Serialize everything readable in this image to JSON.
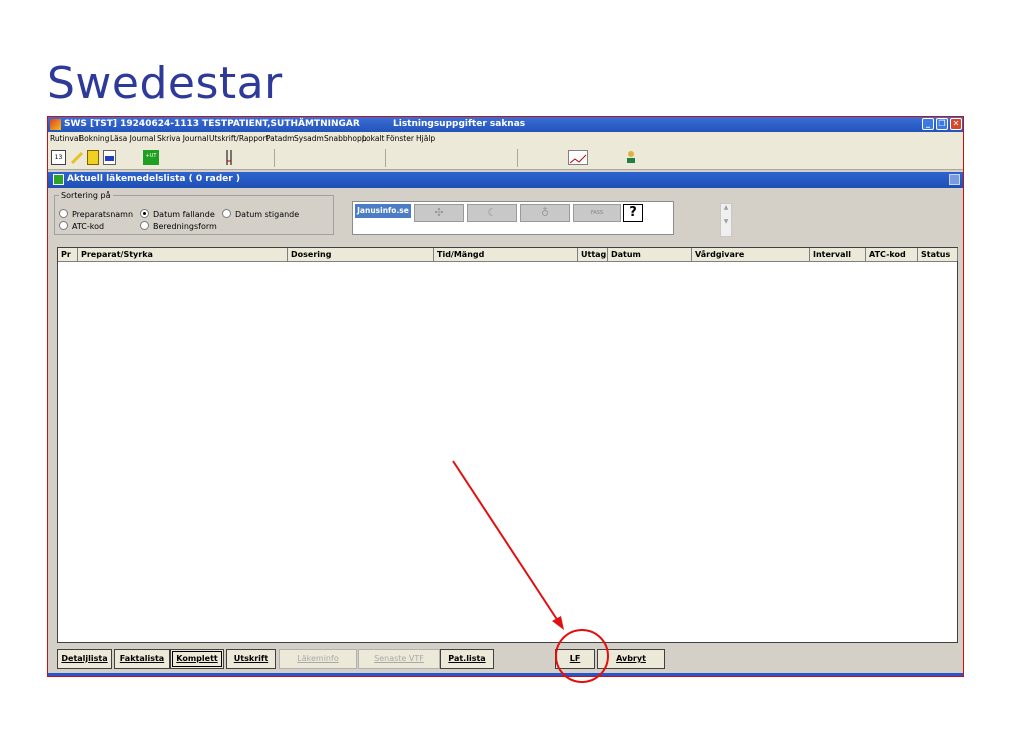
{
  "slide": {
    "title": "Swedestar"
  },
  "window": {
    "title": "SWS  [TST]  19240624-1113  TESTPATIENT,SUTHÄMTNINGAR",
    "status": "Listningsuppgifter saknas"
  },
  "menu": [
    "Rutinval",
    "Bokning",
    "Läsa Journal",
    "Skriva Journal",
    "Utskrift/Rapport",
    "Patadm",
    "Sysadm",
    "Snabbhopp",
    "Lokalt",
    "Fönster",
    "Hjälp"
  ],
  "toolbar": {
    "ut_label": "+UT"
  },
  "subwindow": {
    "title": "Aktuell läkemedelslista ( 0 rader )"
  },
  "sorting": {
    "legend": "Sortering på",
    "options": [
      "Preparatsnamn",
      "Datum fallande",
      "Datum stigande",
      "ATC-kod",
      "Beredningsform"
    ],
    "selected": "Datum fallande"
  },
  "infobox": {
    "janus": "Janusinfo.se",
    "fass": "FASS",
    "help": "?"
  },
  "table": {
    "columns": [
      "Pr",
      "Preparat/Styrka",
      "Dosering",
      "Tid/Mängd",
      "Uttag",
      "Datum",
      "Vårdgivare",
      "Intervall",
      "ATC-kod",
      "Status"
    ]
  },
  "buttons": [
    "Detaljlista",
    "Faktalista",
    "Komplett",
    "Utskrift",
    "Läkeminfo",
    "Senaste VTF",
    "Pat.lista",
    "LF",
    "Avbryt"
  ],
  "colors": {
    "title": "#2e3a9a",
    "titlebar": "#2353b9",
    "annotation": "#e01010",
    "frame": "#c01414"
  }
}
